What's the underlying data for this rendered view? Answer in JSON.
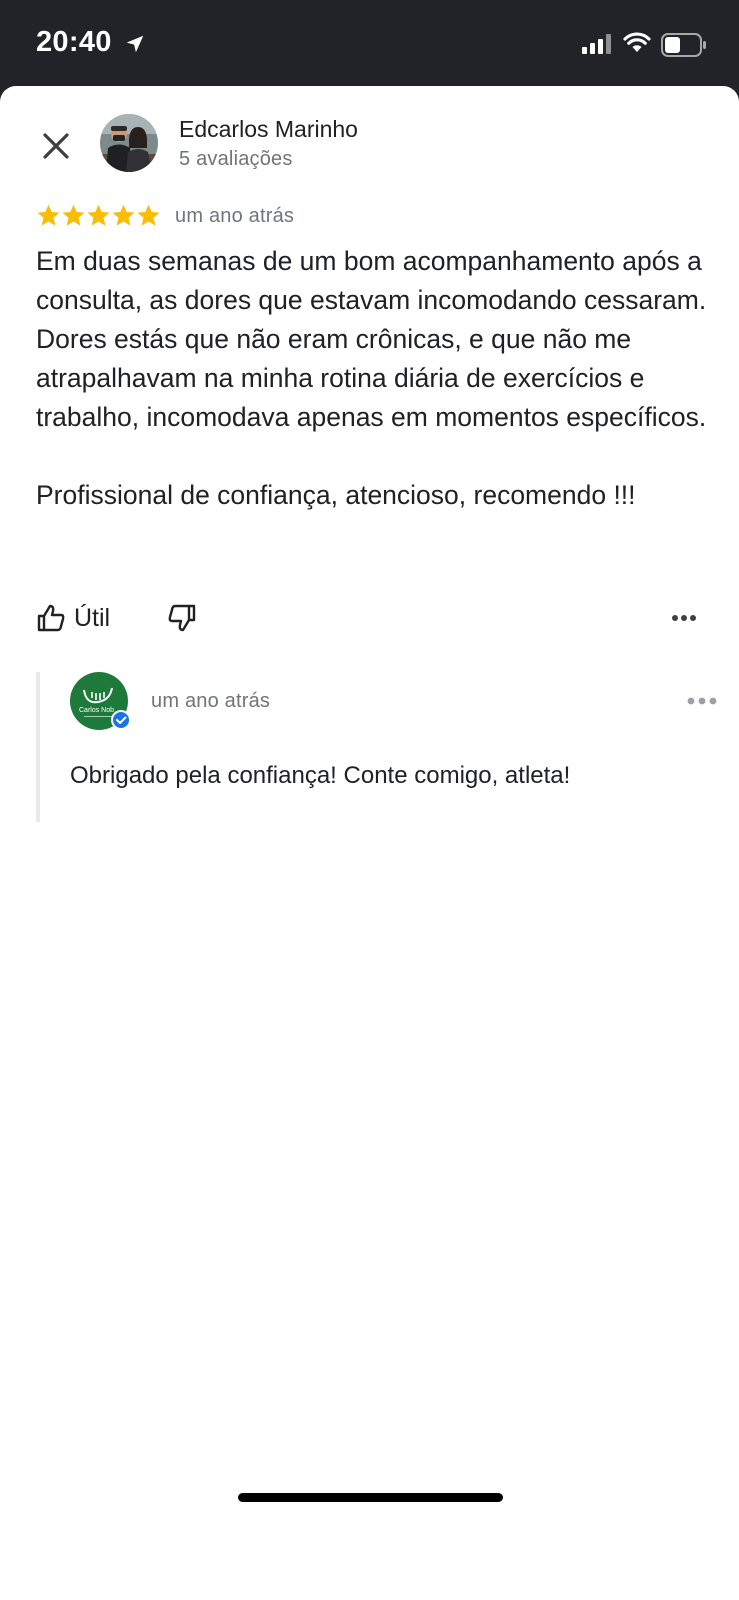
{
  "status_bar": {
    "time": "20:40",
    "icons": [
      "location-arrow-icon",
      "cellular-signal-icon",
      "wifi-icon",
      "battery-icon"
    ]
  },
  "review": {
    "reviewer_name": "Edcarlos Marinho",
    "review_count": "5 avaliações",
    "rating": 5,
    "rating_max": 5,
    "time_ago": "um ano atrás",
    "paragraphs": [
      "Em duas semanas de um bom acompanhamento após a consulta, as dores que estavam incomodando cessaram. Dores estás que não eram crônicas, e que não me atrapalhavam na minha rotina diária de exercícios e trabalho, incomodava apenas em momentos específicos.",
      "Profissional de confiança, atencioso, recomendo !!!"
    ]
  },
  "actions": {
    "useful_label": "Útil"
  },
  "reply": {
    "avatar_logo_text": "Carlos Nob",
    "time_ago": "um ano atrás",
    "text": "Obrigado pela confiança! Conte comigo, atleta!"
  },
  "colors": {
    "star": "#FBBC04",
    "verified_badge": "#1A73E8",
    "owner_logo_bg": "#1E7A3A",
    "text_primary": "#202124",
    "text_secondary": "#70757A"
  }
}
